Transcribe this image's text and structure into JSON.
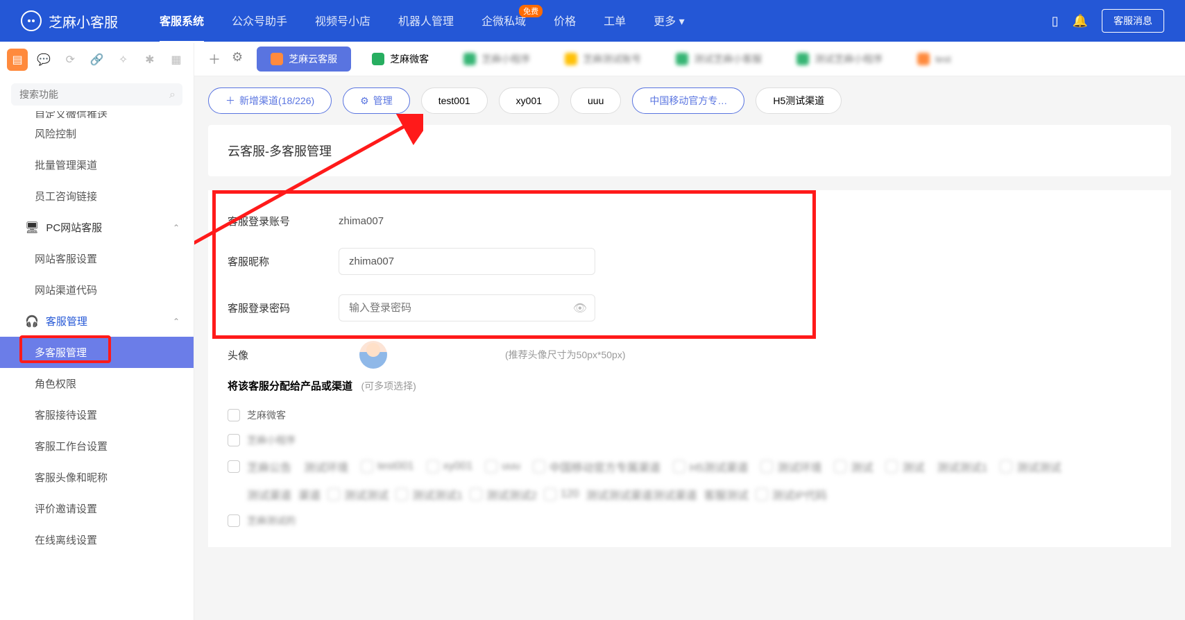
{
  "header": {
    "logo": "芝麻小客服",
    "nav": [
      {
        "label": "客服系统",
        "active": true
      },
      {
        "label": "公众号助手"
      },
      {
        "label": "视频号小店"
      },
      {
        "label": "机器人管理"
      },
      {
        "label": "企微私域",
        "badge": "免费"
      },
      {
        "label": "价格"
      },
      {
        "label": "工单"
      },
      {
        "label": "更多"
      }
    ],
    "button": "客服消息"
  },
  "sidebar": {
    "search_placeholder": "搜索功能",
    "items": {
      "i0": "自定义微信推送",
      "i1": "风险控制",
      "i2": "批量管理渠道",
      "i3": "员工咨询链接"
    },
    "group1": "PC网站客服",
    "group1_items": {
      "a": "网站客服设置",
      "b": "网站渠道代码"
    },
    "group2": "客服管理",
    "group2_items": {
      "a": "多客服管理",
      "b": "角色权限",
      "c": "客服接待设置",
      "d": "客服工作台设置",
      "e": "客服头像和昵称",
      "f": "评价邀请设置",
      "g": "在线离线设置"
    }
  },
  "tabs": {
    "t1": "芝麻云客服",
    "t2": "芝麻微客"
  },
  "filters": {
    "add": "新增渠道(18/226)",
    "manage": "管理",
    "p1": "test001",
    "p2": "xy001",
    "p3": "uuu",
    "p4": "中国移动官方专…",
    "p5": "H5测试渠道"
  },
  "page": {
    "title": "云客服-多客服管理"
  },
  "form": {
    "account_label": "客服登录账号",
    "account_value": "zhima007",
    "nick_label": "客服昵称",
    "nick_value": "zhima007",
    "pwd_label": "客服登录密码",
    "pwd_placeholder": "输入登录密码",
    "avatar_label": "头像",
    "avatar_hint": "(推荐头像尺寸为50px*50px)"
  },
  "assign": {
    "title": "将该客服分配给产品或渠道",
    "subtitle": "(可多项选择)",
    "opt1": "芝麻微客"
  }
}
